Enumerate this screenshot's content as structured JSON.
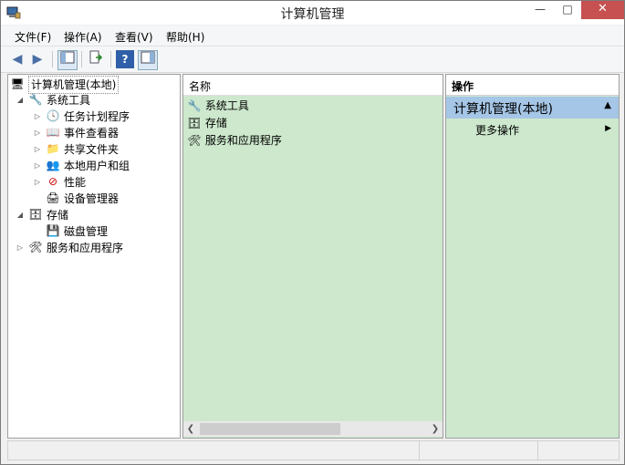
{
  "window": {
    "title": "计算机管理"
  },
  "menu": [
    {
      "label": "文件(F)"
    },
    {
      "label": "操作(A)"
    },
    {
      "label": "查看(V)"
    },
    {
      "label": "帮助(H)"
    }
  ],
  "tree": {
    "root": "计算机管理(本地)",
    "items": [
      {
        "label": "系统工具",
        "icon": "tools-icon"
      },
      {
        "label": "任务计划程序",
        "icon": "clock-icon"
      },
      {
        "label": "事件查看器",
        "icon": "event-viewer-icon"
      },
      {
        "label": "共享文件夹",
        "icon": "shared-folder-icon"
      },
      {
        "label": "本地用户和组",
        "icon": "users-icon"
      },
      {
        "label": "性能",
        "icon": "performance-icon"
      },
      {
        "label": "设备管理器",
        "icon": "device-manager-icon"
      },
      {
        "label": "存储",
        "icon": "storage-icon"
      },
      {
        "label": "磁盘管理",
        "icon": "disk-icon"
      },
      {
        "label": "服务和应用程序",
        "icon": "services-icon"
      }
    ]
  },
  "center": {
    "column_header": "名称",
    "rows": [
      {
        "label": "系统工具"
      },
      {
        "label": "存储"
      },
      {
        "label": "服务和应用程序"
      }
    ]
  },
  "actions": {
    "header": "操作",
    "group_title": "计算机管理(本地)",
    "items": [
      {
        "label": "更多操作"
      }
    ]
  }
}
